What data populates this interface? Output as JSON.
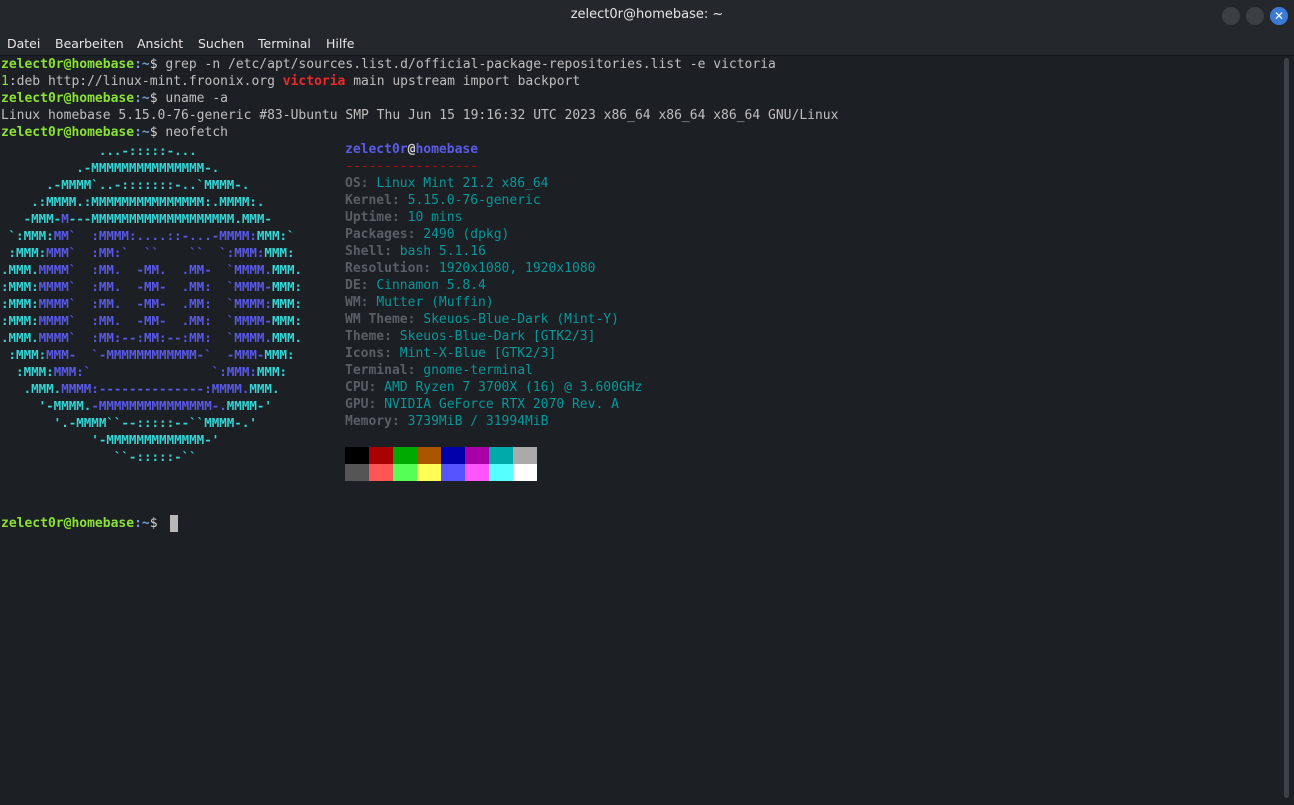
{
  "window": {
    "title": "zelect0r@homebase: ~",
    "accent_close": "#3a7bd5"
  },
  "menu": [
    "Datei",
    "Bearbeiten",
    "Ansicht",
    "Suchen",
    "Terminal",
    "Hilfe"
  ],
  "prompt": {
    "user_host": "zelect0r@homebase",
    "path": ":~",
    "dollar": "$"
  },
  "terminal": {
    "cmd1": " grep -n /etc/apt/sources.list.d/official-package-repositories.list -e victoria",
    "out1_num": "1",
    "out1_pre": ":deb http://linux-mint.froonix.org ",
    "out1_match": "victoria",
    "out1_post": " main upstream import backport",
    "cmd2": " uname -a",
    "out2": "Linux homebase 5.15.0-76-generic #83-Ubuntu SMP Thu Jun 15 19:16:32 UTC 2023 x86_64 x86_64 x86_64 GNU/Linux",
    "cmd3": " neofetch",
    "final_prompt_suffix": " "
  },
  "neofetch": {
    "header_user": "zelect0r",
    "header_at": "@",
    "header_host": "homebase",
    "separator": "-----------------",
    "items": [
      {
        "key": "OS",
        "value": "Linux Mint 21.2 x86_64"
      },
      {
        "key": "Kernel",
        "value": "5.15.0-76-generic"
      },
      {
        "key": "Uptime",
        "value": "10 mins"
      },
      {
        "key": "Packages",
        "value": "2490 (dpkg)"
      },
      {
        "key": "Shell",
        "value": "bash 5.1.16"
      },
      {
        "key": "Resolution",
        "value": "1920x1080, 1920x1080"
      },
      {
        "key": "DE",
        "value": "Cinnamon 5.8.4"
      },
      {
        "key": "WM",
        "value": "Mutter (Muffin)"
      },
      {
        "key": "WM Theme",
        "value": "Skeuos-Blue-Dark (Mint-Y)"
      },
      {
        "key": "Theme",
        "value": "Skeuos-Blue-Dark [GTK2/3]"
      },
      {
        "key": "Icons",
        "value": "Mint-X-Blue [GTK2/3]"
      },
      {
        "key": "Terminal",
        "value": "gnome-terminal"
      },
      {
        "key": "CPU",
        "value": "AMD Ryzen 7 3700X (16) @ 3.600GHz"
      },
      {
        "key": "GPU",
        "value": "NVIDIA GeForce RTX 2070 Rev. A"
      },
      {
        "key": "Memory",
        "value": "3739MiB / 31994MiB"
      }
    ],
    "palette_top": [
      "#000000",
      "#aa0000",
      "#00aa00",
      "#aa5500",
      "#0000aa",
      "#aa00aa",
      "#00aaaa",
      "#aaaaaa"
    ],
    "palette_bottom": [
      "#555555",
      "#ff5555",
      "#55ff55",
      "#ffff55",
      "#5555ff",
      "#ff55ff",
      "#55ffff",
      "#ffffff"
    ]
  },
  "logo": [
    [
      [
        "c1",
        "             ...-:::::-..."
      ]
    ],
    [
      [
        "c1",
        "          .-MMMMMMMMMMMMMMM-."
      ]
    ],
    [
      [
        "c1",
        "      .-MMMM`..-:::::::-..`MMMM-."
      ]
    ],
    [
      [
        "c1",
        "    .:MMMM.:MMMMMMMMMMMMMMM:.MMMM:."
      ]
    ],
    [
      [
        "c1",
        "   -MMM-"
      ],
      [
        "c2",
        "M"
      ],
      [
        "c1",
        "---MMMMMMMMMMMMMMMMMMM.MMM-"
      ]
    ],
    [
      [
        "c1",
        " `:MMM:"
      ],
      [
        "c2",
        "MM`  :MMMM:....::-...-MMMM:"
      ],
      [
        "c1",
        "MMM:`"
      ]
    ],
    [
      [
        "c1",
        " :MMM:"
      ],
      [
        "c2",
        "MMM`  :MM:`  ``    ``  `:MMM:"
      ],
      [
        "c1",
        "MMM:"
      ]
    ],
    [
      [
        "c1",
        ".MMM."
      ],
      [
        "c2",
        "MMMM`  :MM.  -MM.  .MM-  `MMMM."
      ],
      [
        "c1",
        "MMM."
      ]
    ],
    [
      [
        "c1",
        ":MMM:"
      ],
      [
        "c2",
        "MMMM`  :MM.  -MM-  .MM:  `MMMM-"
      ],
      [
        "c1",
        "MMM:"
      ]
    ],
    [
      [
        "c1",
        ":MMM:"
      ],
      [
        "c2",
        "MMMM`  :MM.  -MM-  .MM:  `MMMM:"
      ],
      [
        "c1",
        "MMM:"
      ]
    ],
    [
      [
        "c1",
        ":MMM:"
      ],
      [
        "c2",
        "MMMM`  :MM.  -MM-  .MM:  `MMMM-"
      ],
      [
        "c1",
        "MMM:"
      ]
    ],
    [
      [
        "c1",
        ".MMM."
      ],
      [
        "c2",
        "MMMM`  :MM:--:MM:--:MM:  `MMMM."
      ],
      [
        "c1",
        "MMM."
      ]
    ],
    [
      [
        "c1",
        " :MMM:"
      ],
      [
        "c2",
        "MMM-  `-MMMMMMMMMMMM-`  -MMM-"
      ],
      [
        "c1",
        "MMM:"
      ]
    ],
    [
      [
        "c1",
        "  :MMM:"
      ],
      [
        "c2",
        "MMM:`                `:MMM:"
      ],
      [
        "c1",
        "MMM:"
      ]
    ],
    [
      [
        "c1",
        "   .MMM."
      ],
      [
        "c2",
        "MMMM:--------------:MMMM."
      ],
      [
        "c1",
        "MMM."
      ]
    ],
    [
      [
        "c1",
        "     '-MMMM."
      ],
      [
        "c2",
        "-MMMMMMMMMMMMMMM-."
      ],
      [
        "c1",
        "MMMM-'"
      ]
    ],
    [
      [
        "c1",
        "       '.-MMMM``--:::::--``MMMM-.'"
      ]
    ],
    [
      [
        "c1",
        "            '-MMMMMMMMMMMMM-'"
      ]
    ],
    [
      [
        "c1",
        "               ``-:::::-``"
      ]
    ]
  ]
}
